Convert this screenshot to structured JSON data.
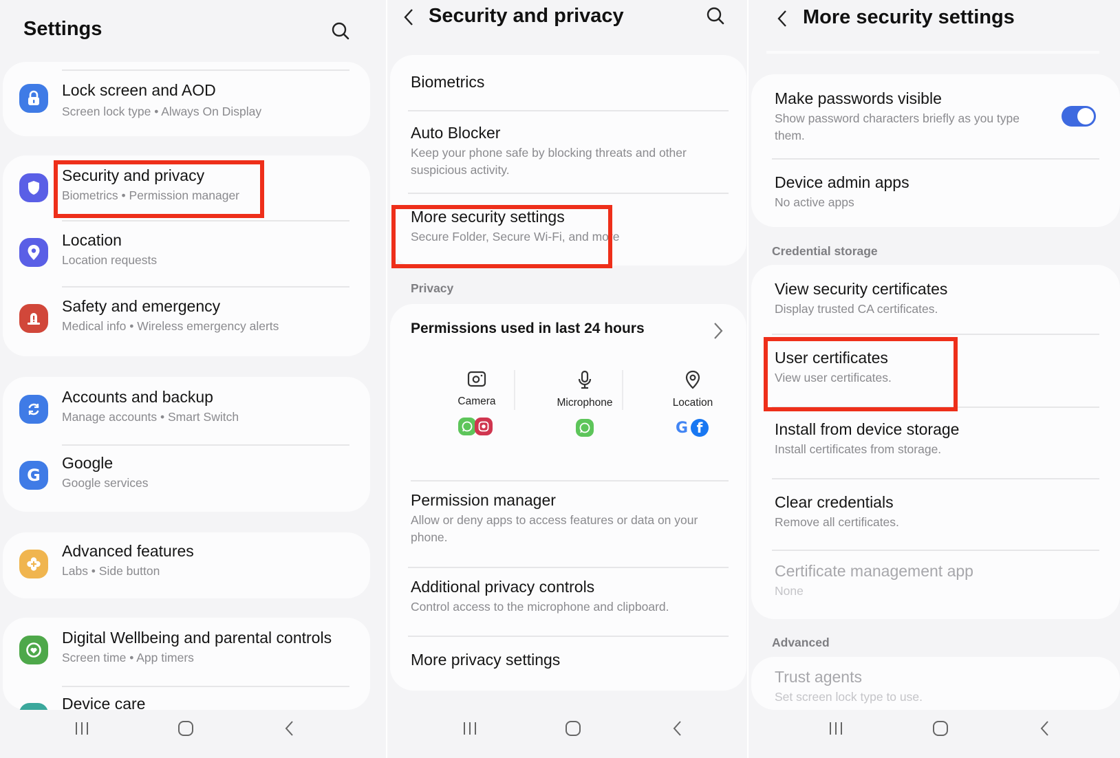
{
  "colors": {
    "highlight": "#ee2f1a",
    "toggle_on": "#3e6ae0",
    "icon_lock": "#3f7be6",
    "icon_security": "#5a5fe6",
    "icon_location": "#5a5fe6",
    "icon_safety": "#d1473a",
    "icon_accounts": "#3f7be6",
    "icon_google": "#3f7be6",
    "icon_advanced": "#f0b54f",
    "icon_wellbeing": "#4ea84a",
    "icon_device_care": "#3ba89c"
  },
  "panel1": {
    "title": "Settings",
    "search_icon": "search-icon",
    "items": [
      {
        "title": "Lock screen and AOD",
        "subtitle": "Screen lock type  •  Always On Display",
        "icon": "lock-icon"
      },
      {
        "title": "Security and privacy",
        "subtitle": "Biometrics  •  Permission manager",
        "icon": "shield-icon",
        "highlighted": true
      },
      {
        "title": "Location",
        "subtitle": "Location requests",
        "icon": "location-pin-icon"
      },
      {
        "title": "Safety and emergency",
        "subtitle": "Medical info  •  Wireless emergency alerts",
        "icon": "emergency-icon"
      },
      {
        "title": "Accounts and backup",
        "subtitle": "Manage accounts  •  Smart Switch",
        "icon": "sync-icon"
      },
      {
        "title": "Google",
        "subtitle": "Google services",
        "icon": "google-icon"
      },
      {
        "title": "Advanced features",
        "subtitle": "Labs  •  Side button",
        "icon": "advanced-features-icon"
      },
      {
        "title": "Digital Wellbeing and parental controls",
        "subtitle": "Screen time  •  App timers",
        "icon": "wellbeing-icon"
      },
      {
        "title": "Device care",
        "icon": "device-care-icon"
      }
    ]
  },
  "panel2": {
    "title": "Security and privacy",
    "items": [
      {
        "title": "Biometrics"
      },
      {
        "title": "Auto Blocker",
        "subtitle_line1": "Keep your phone safe by blocking threats and other",
        "subtitle_line2": "suspicious activity."
      },
      {
        "title": "More security settings",
        "subtitle": "Secure Folder, Secure Wi-Fi, and more",
        "highlighted": true
      }
    ],
    "privacy_section": "Privacy",
    "permissions": {
      "title": "Permissions used in last 24 hours",
      "columns": [
        {
          "label": "Camera",
          "icon": "camera-icon",
          "apps": [
            "WhatsApp",
            "Instagram"
          ]
        },
        {
          "label": "Microphone",
          "icon": "microphone-icon",
          "apps": [
            "WhatsApp"
          ]
        },
        {
          "label": "Location",
          "icon": "location-pin-icon",
          "apps": [
            "Google",
            "Facebook"
          ]
        }
      ]
    },
    "privacy_items": [
      {
        "title": "Permission manager",
        "subtitle_line1": "Allow or deny apps to access features or data on your",
        "subtitle_line2": "phone."
      },
      {
        "title": "Additional privacy controls",
        "subtitle": "Control access to the microphone and clipboard."
      },
      {
        "title": "More privacy settings"
      }
    ]
  },
  "panel3": {
    "title": "More security settings",
    "items": [
      {
        "title": "Make passwords visible",
        "subtitle_line1": "Show password characters briefly as you type",
        "subtitle_line2": "them.",
        "toggle_on": true
      },
      {
        "title": "Device admin apps",
        "subtitle": "No active apps"
      }
    ],
    "credential_section": "Credential storage",
    "credential_items": [
      {
        "title": "View security certificates",
        "subtitle": "Display trusted CA certificates."
      },
      {
        "title": "User certificates",
        "subtitle": "View user certificates.",
        "highlighted": true
      },
      {
        "title": "Install from device storage",
        "subtitle": "Install certificates from storage."
      },
      {
        "title": "Clear credentials",
        "subtitle": "Remove all certificates."
      },
      {
        "title": "Certificate management app",
        "subtitle": "None",
        "disabled": true
      }
    ],
    "advanced_section": "Advanced",
    "advanced_items": [
      {
        "title": "Trust agents",
        "subtitle": "Set screen lock type to use.",
        "disabled": true
      }
    ]
  },
  "navbar": {
    "recents": "recent-apps-icon",
    "home": "home-icon",
    "back": "back-icon"
  }
}
